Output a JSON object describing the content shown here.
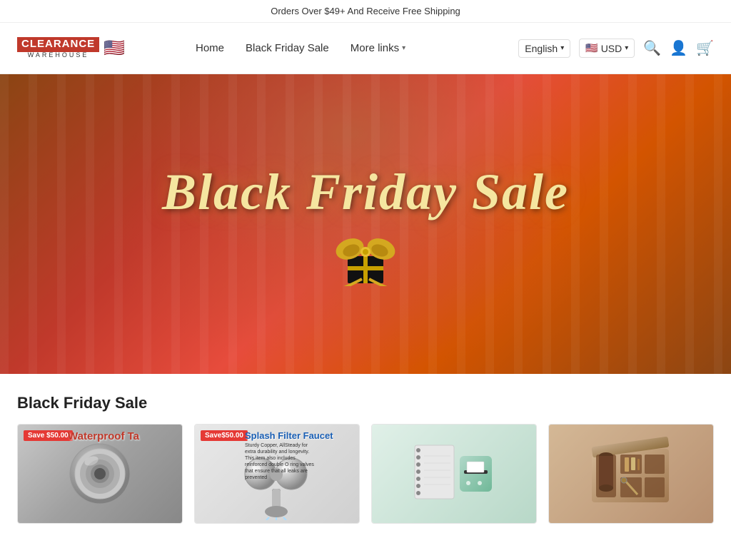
{
  "topBanner": {
    "text": "Orders Over $49+ And Receive Free Shipping"
  },
  "header": {
    "logo": {
      "clearance": "CLEARANCE",
      "warehouse": "WAREHOUSE"
    },
    "nav": {
      "home": "Home",
      "blackFridaySale": "Black Friday Sale",
      "moreLinks": "More links"
    },
    "language": "English",
    "currency": "USD"
  },
  "hero": {
    "title": "Black Friday Sale"
  },
  "productsSection": {
    "title": "Black Friday Sale",
    "products": [
      {
        "id": 1,
        "saveBadge": "Save $50.00",
        "label": "Waterproof Ta",
        "type": "tape"
      },
      {
        "id": 2,
        "saveBadge": "Save$50.00",
        "title": "Splash Filter Faucet",
        "description": "Sturdy Copper, AllSteady for extra durability and longevity. This item also includes reinforced double O ring valves that ensure that all leaks are prevented",
        "type": "faucet"
      },
      {
        "id": 3,
        "type": "printer"
      },
      {
        "id": 4,
        "type": "organizer"
      }
    ]
  }
}
